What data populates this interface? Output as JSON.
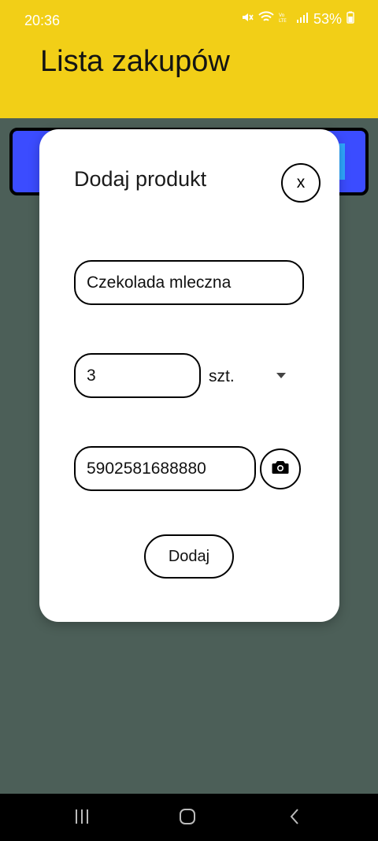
{
  "status_bar": {
    "time": "20:36",
    "battery": "53%"
  },
  "app": {
    "title": "Lista zakupów"
  },
  "dialog": {
    "title": "Dodaj produkt",
    "close_label": "x",
    "name_value": "Czekolada mleczna",
    "quantity_value": "3",
    "unit_selected": "szt.",
    "barcode_value": "5902581688880",
    "submit_label": "Dodaj"
  },
  "background_item": {
    "text": ""
  },
  "colors": {
    "header": "#f2cf17",
    "backdrop": "#4c5f58",
    "list_item": "#3b4cff",
    "dialog": "#ffffff"
  },
  "icons": {
    "close": "close-icon",
    "camera": "camera-icon",
    "dropdown": "chevron-down-icon",
    "recent": "recent-apps-icon",
    "home": "home-icon",
    "back": "back-icon"
  }
}
